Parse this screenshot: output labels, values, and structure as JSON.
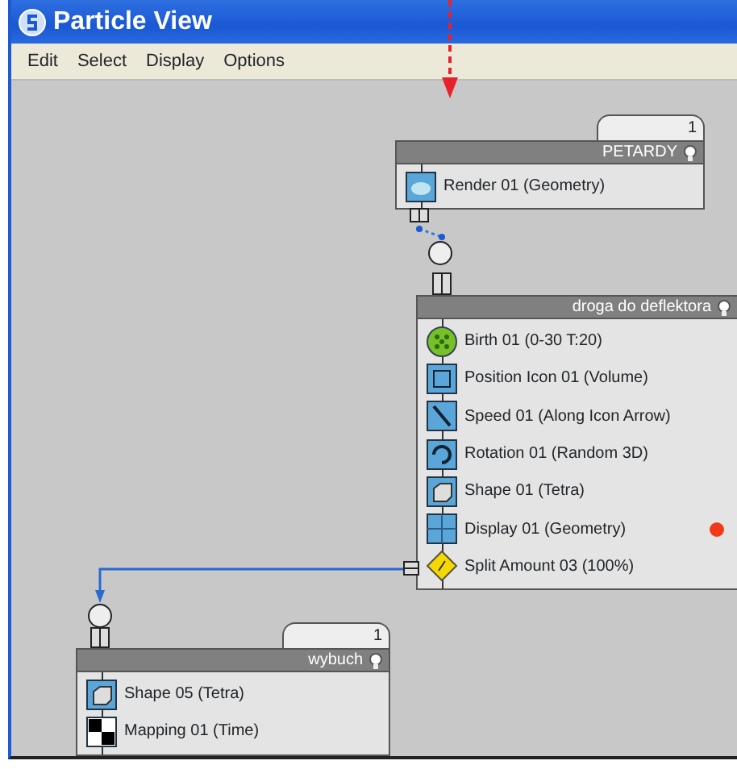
{
  "window": {
    "title": "Particle View"
  },
  "menu": [
    "Edit",
    "Select",
    "Display",
    "Options"
  ],
  "events": [
    {
      "name": "PETARDY",
      "tab": "1",
      "operators": [
        {
          "kind": "render",
          "label": "Render 01 (Geometry)",
          "marked": false
        }
      ]
    },
    {
      "name": "droga do deflektora",
      "operators": [
        {
          "kind": "birth",
          "label": "Birth 01 (0-30 T:20)",
          "marked": false
        },
        {
          "kind": "position",
          "label": "Position Icon 01 (Volume)",
          "marked": false
        },
        {
          "kind": "speed",
          "label": "Speed 01 (Along Icon Arrow)",
          "marked": false
        },
        {
          "kind": "rotation",
          "label": "Rotation 01 (Random 3D)",
          "marked": false
        },
        {
          "kind": "shape",
          "label": "Shape 01 (Tetra)",
          "marked": false
        },
        {
          "kind": "display",
          "label": "Display 01 (Geometry)",
          "marked": true
        },
        {
          "kind": "split",
          "label": "Split Amount 03 (100%)",
          "marked": false
        }
      ]
    },
    {
      "name": "wybuch",
      "tab": "1",
      "operators": [
        {
          "kind": "shape",
          "label": "Shape 05 (Tetra)",
          "marked": false
        },
        {
          "kind": "mapping",
          "label": "Mapping 01 (Time)",
          "marked": false
        }
      ]
    }
  ]
}
